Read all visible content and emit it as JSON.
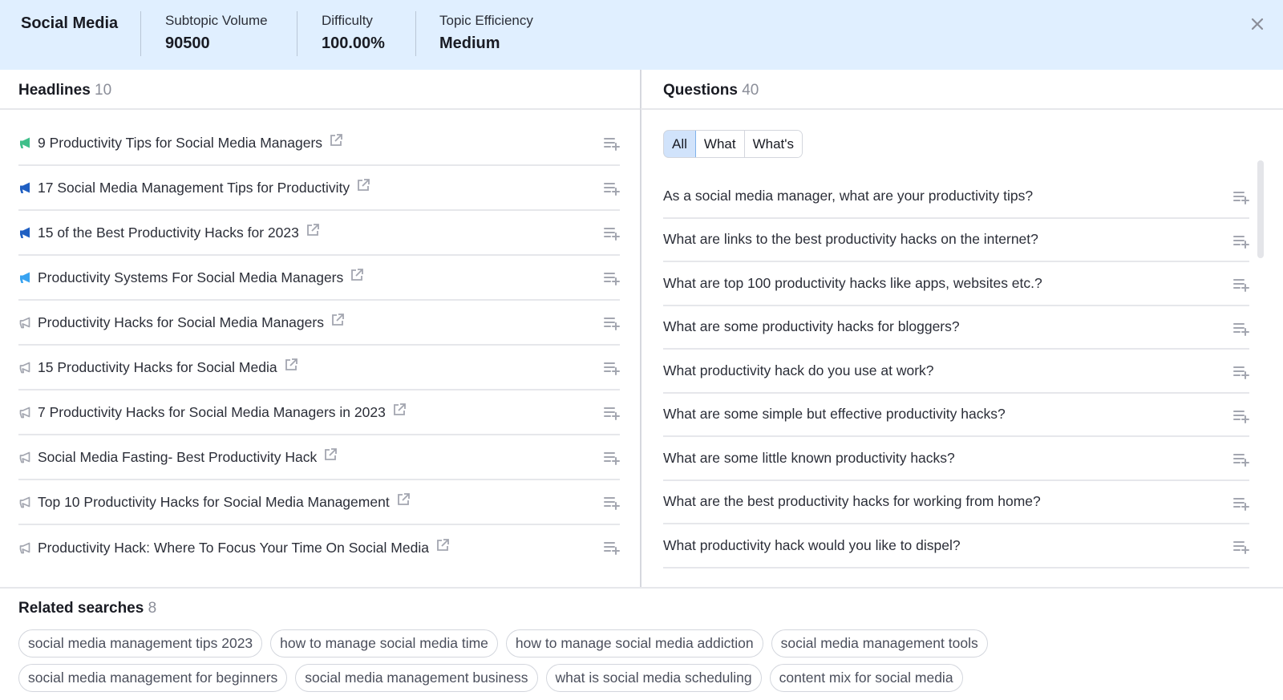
{
  "header": {
    "title": "Social Media",
    "metrics": [
      {
        "label": "Subtopic Volume",
        "value": "90500"
      },
      {
        "label": "Difficulty",
        "value": "100.00%"
      },
      {
        "label": "Topic Efficiency",
        "value": "Medium"
      }
    ],
    "close_icon": "close-icon"
  },
  "headlines": {
    "title": "Headlines",
    "count": "10",
    "items": [
      {
        "text": "9 Productivity Tips for Social Media Managers",
        "icon": "megaphone-filled",
        "color": "#3fbf8a"
      },
      {
        "text": "17 Social Media Management Tips for Productivity",
        "icon": "megaphone-filled",
        "color": "#1f5fc2"
      },
      {
        "text": "15 of the Best Productivity Hacks for 2023",
        "icon": "megaphone-filled",
        "color": "#1f5fc2"
      },
      {
        "text": "Productivity Systems For Social Media Managers",
        "icon": "megaphone-filled",
        "color": "#38a3f1"
      },
      {
        "text": "Productivity Hacks for Social Media Managers",
        "icon": "megaphone-outline",
        "color": "#a3a6b0"
      },
      {
        "text": "15 Productivity Hacks for Social Media",
        "icon": "megaphone-outline",
        "color": "#a3a6b0"
      },
      {
        "text": "7 Productivity Hacks for Social Media Managers in 2023",
        "icon": "megaphone-outline",
        "color": "#a3a6b0"
      },
      {
        "text": "Social Media Fasting- Best Productivity Hack",
        "icon": "megaphone-outline",
        "color": "#a3a6b0"
      },
      {
        "text": "Top 10 Productivity Hacks for Social Media Management",
        "icon": "megaphone-outline",
        "color": "#a3a6b0"
      },
      {
        "text": "Productivity Hack: Where To Focus Your Time On Social Media",
        "icon": "megaphone-outline",
        "color": "#a3a6b0"
      }
    ]
  },
  "questions": {
    "title": "Questions",
    "count": "40",
    "filters": [
      {
        "label": "All",
        "active": true
      },
      {
        "label": "What",
        "active": false
      },
      {
        "label": "What's",
        "active": false
      }
    ],
    "items": [
      "As a social media manager, what are your productivity tips?",
      "What are links to the best productivity hacks on the internet?",
      "What are top 100 productivity hacks like apps, websites etc.?",
      "What are some productivity hacks for bloggers?",
      "What productivity hack do you use at work?",
      "What are some simple but effective productivity hacks?",
      "What are some little known productivity hacks?",
      "What are the best productivity hacks for working from home?",
      "What productivity hack would you like to dispel?"
    ]
  },
  "related": {
    "title": "Related searches",
    "count": "8",
    "items": [
      "social media management tips 2023",
      "how to manage social media time",
      "how to manage social media addiction",
      "social media management tools",
      "social media management for beginners",
      "social media management business",
      "what is social media scheduling",
      "content mix for social media"
    ]
  },
  "colors": {
    "header_bg": "#e0efff",
    "active_filter_bg": "#d1e3fb",
    "icon_gray": "#a3a6b0"
  }
}
